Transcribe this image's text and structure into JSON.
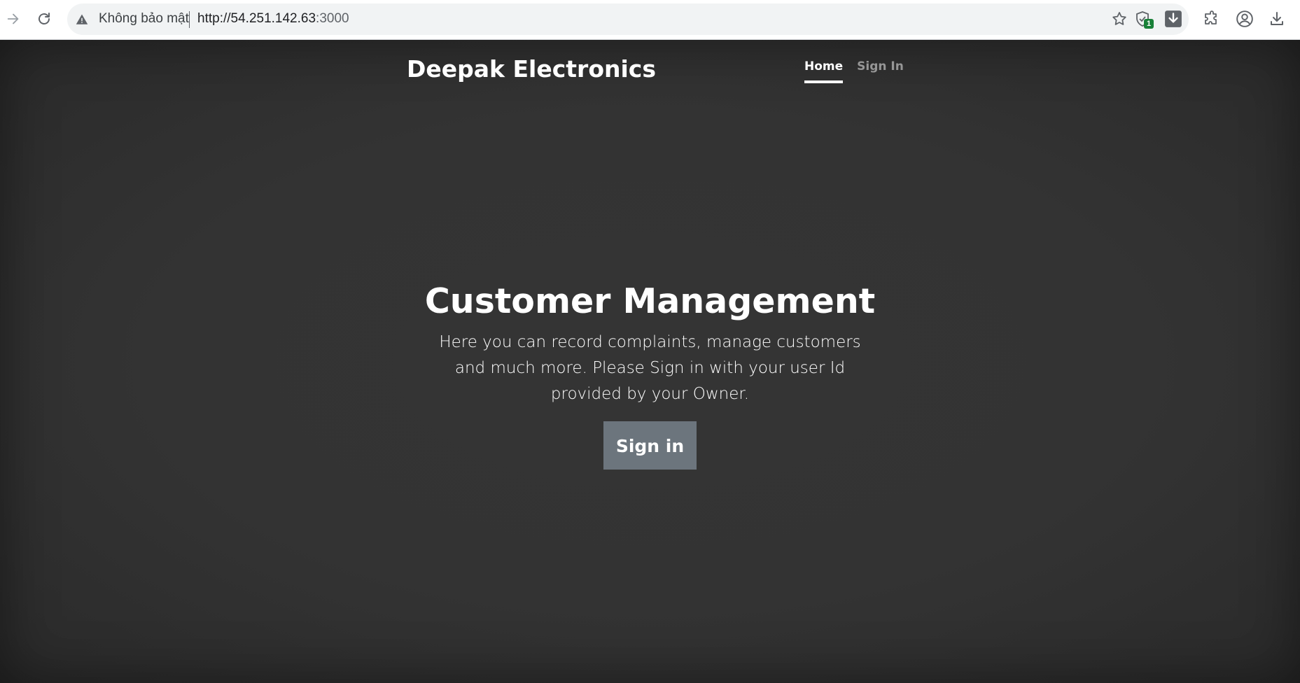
{
  "browser": {
    "security_label": "Không bảo mật",
    "url_host": "http://54.251.142.63",
    "url_port": ":3000",
    "extension_badge": "1"
  },
  "site": {
    "brand": "Deepak Electronics",
    "nav": [
      {
        "label": "Home",
        "active": true
      },
      {
        "label": "Sign In",
        "active": false
      }
    ]
  },
  "hero": {
    "title": "Customer Management",
    "lead": "Here you can record complaints, manage customers and much more. Please Sign in with your user Id provided by your Owner.",
    "button_label": "Sign in"
  },
  "colors": {
    "page_background": "#333333",
    "button_background": "#6c757d",
    "text": "#ffffff"
  }
}
